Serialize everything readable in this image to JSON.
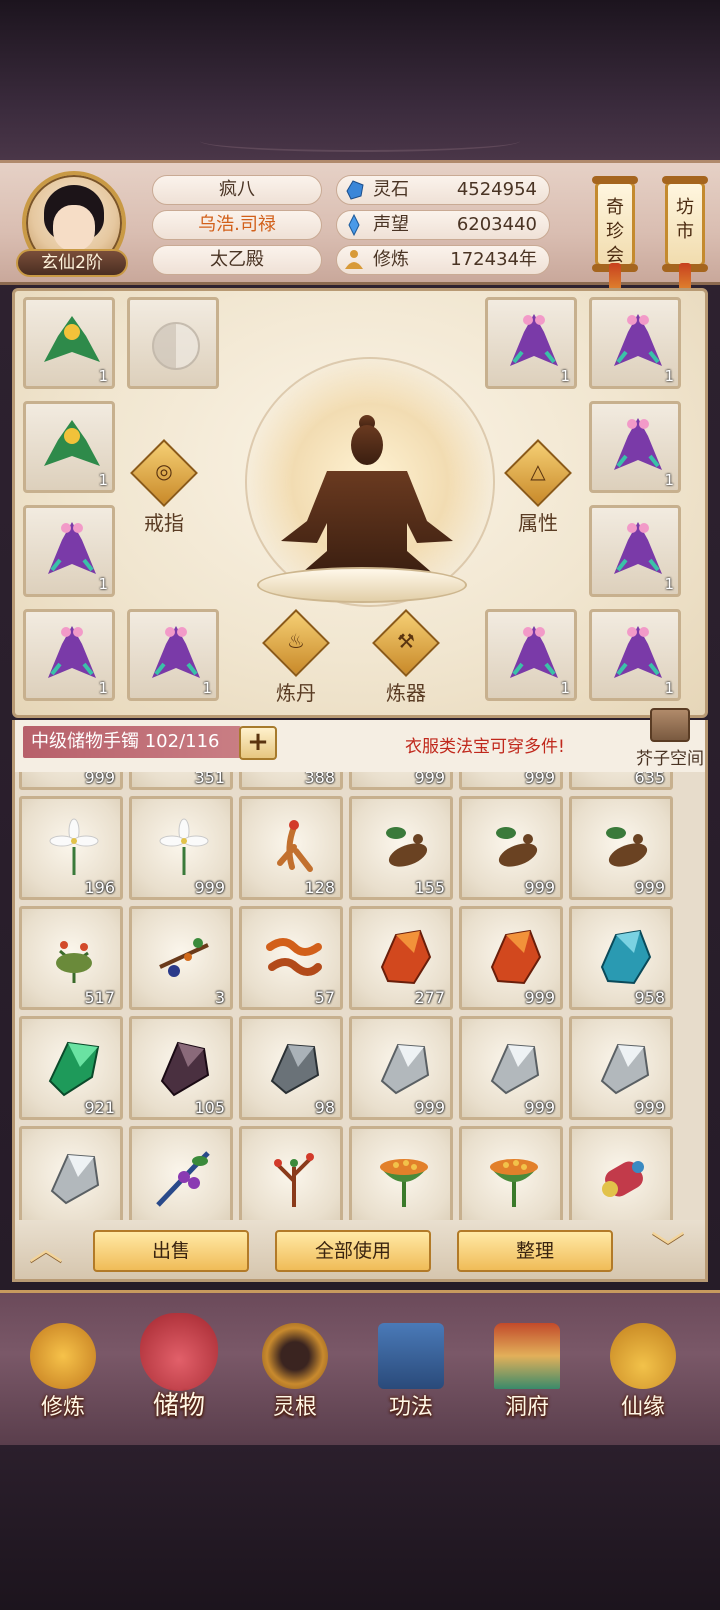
{
  "player": {
    "rank": "玄仙2阶",
    "name": "疯八",
    "title": "乌浩.司禄",
    "sect": "太乙殿"
  },
  "stats": [
    {
      "label": "灵石",
      "value": "4524954",
      "icon": "spirit-stone-icon",
      "color": "#3a86d8"
    },
    {
      "label": "声望",
      "value": "6203440",
      "icon": "reputation-icon",
      "color": "#4a9ae8"
    },
    {
      "label": "修炼",
      "value": "172434年",
      "icon": "meditation-icon",
      "color": "#d89a38"
    }
  ],
  "side_buttons": [
    {
      "label": "奇珍会"
    },
    {
      "label": "坊市"
    }
  ],
  "equipment": {
    "slots_left": [
      {
        "count": "1",
        "kind": "green"
      },
      {
        "count": "",
        "kind": "empty"
      },
      {
        "count": "1",
        "kind": "green"
      },
      {
        "count": "1",
        "kind": "purple"
      },
      {
        "count": "1",
        "kind": "purple"
      },
      {
        "count": "1",
        "kind": "purple"
      }
    ],
    "slots_right": [
      {
        "count": "1",
        "kind": "purple"
      },
      {
        "count": "1",
        "kind": "purple"
      },
      {
        "count": "1",
        "kind": "purple"
      },
      {
        "count": "1",
        "kind": "purple"
      },
      {
        "count": "1",
        "kind": "purple"
      },
      {
        "count": "1",
        "kind": "purple"
      }
    ],
    "actions": {
      "ring": "戒指",
      "attribute": "属性",
      "alchemy": "炼丹",
      "forge": "炼器"
    }
  },
  "bag": {
    "title": "中级储物手镯 102/116",
    "hint": "衣服类法宝可穿多件!",
    "space_label": "芥子空间",
    "partial_counts": [
      "999",
      "351",
      "388",
      "999",
      "999",
      "635"
    ],
    "items": [
      {
        "count": "196",
        "type": "white-flower"
      },
      {
        "count": "999",
        "type": "white-flower"
      },
      {
        "count": "128",
        "type": "ginseng"
      },
      {
        "count": "155",
        "type": "root"
      },
      {
        "count": "999",
        "type": "root"
      },
      {
        "count": "999",
        "type": "root"
      },
      {
        "count": "517",
        "type": "herb"
      },
      {
        "count": "3",
        "type": "berry-branch"
      },
      {
        "count": "57",
        "type": "worm-grass"
      },
      {
        "count": "277",
        "type": "red-ore"
      },
      {
        "count": "999",
        "type": "red-ore"
      },
      {
        "count": "958",
        "type": "blue-ore"
      },
      {
        "count": "921",
        "type": "green-ore"
      },
      {
        "count": "105",
        "type": "dark-ore"
      },
      {
        "count": "98",
        "type": "grey-ore"
      },
      {
        "count": "999",
        "type": "silver-ore"
      },
      {
        "count": "999",
        "type": "silver-ore"
      },
      {
        "count": "999",
        "type": "silver-ore"
      },
      {
        "count": "",
        "type": "silver-ore"
      },
      {
        "count": "",
        "type": "grape-branch"
      },
      {
        "count": "",
        "type": "red-branch"
      },
      {
        "count": "",
        "type": "lotus-pod"
      },
      {
        "count": "",
        "type": "lotus-pod"
      },
      {
        "count": "",
        "type": "scroll-gourd"
      }
    ]
  },
  "actions": {
    "sell": "出售",
    "use_all": "全部使用",
    "sort": "整理"
  },
  "nav": [
    {
      "label": "修炼",
      "icon": "cultivate-icon",
      "active": false
    },
    {
      "label": "储物",
      "icon": "storage-bag-icon",
      "active": true
    },
    {
      "label": "灵根",
      "icon": "spirit-root-icon",
      "active": false
    },
    {
      "label": "功法",
      "icon": "technique-book-icon",
      "active": false
    },
    {
      "label": "洞府",
      "icon": "cave-house-icon",
      "active": false
    },
    {
      "label": "仙缘",
      "icon": "gourd-icon",
      "active": false
    }
  ]
}
